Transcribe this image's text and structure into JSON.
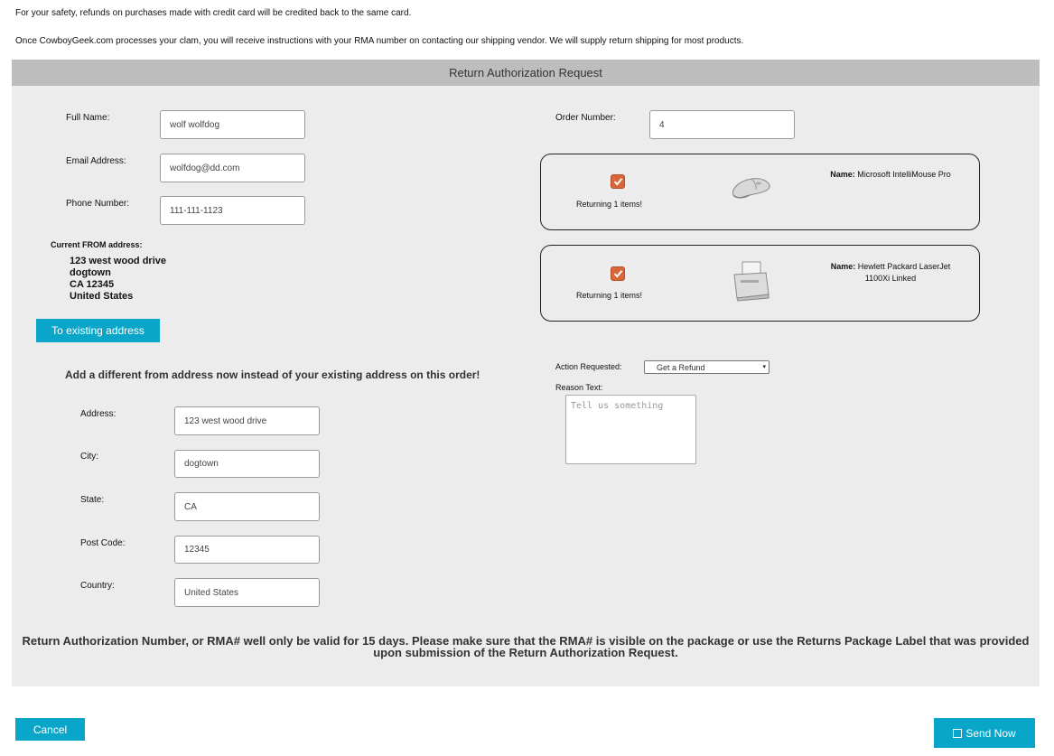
{
  "notes": {
    "refund": "For your safety, refunds on purchases made with credit card will be credited back to the same card.",
    "process": "Once CowboyGeek.com processes your clam, you will receive instructions with your RMA number on contacting our shipping vendor. We will supply return shipping for most products."
  },
  "form": {
    "title": "Return Authorization Request",
    "full_name": {
      "label": "Full Name:",
      "value": "wolf wolfdog"
    },
    "email": {
      "label": "Email Address:",
      "value": "wolfdog@dd.com"
    },
    "phone": {
      "label": "Phone Number:",
      "value": "111-111-1123"
    },
    "order_number": {
      "label": "Order Number:",
      "value": "4"
    },
    "current_from": {
      "label": "Current FROM address:",
      "lines": [
        "123 west wood drive",
        "dogtown",
        "CA 12345",
        "United States"
      ]
    },
    "to_existing_button": "To existing address",
    "different_address_heading": "Add a different from address now instead of your existing address on this order!",
    "address": {
      "label": "Address:",
      "value": "123 west wood drive"
    },
    "city": {
      "label": "City:",
      "value": "dogtown"
    },
    "state": {
      "label": "State:",
      "value": "CA"
    },
    "post_code": {
      "label": "Post Code:",
      "value": "12345"
    },
    "country": {
      "label": "Country:",
      "value": "United States"
    },
    "action": {
      "label": "Action Requested:",
      "value": "Get a Refund"
    },
    "reason": {
      "label": "Reason Text:",
      "placeholder": "Tell us something"
    },
    "items": [
      {
        "checked": true,
        "returning": "Returning 1 items!",
        "name_label": "Name:",
        "name": "Microsoft IntelliMouse Pro",
        "icon": "mouse-icon"
      },
      {
        "checked": true,
        "returning": "Returning 1 items!",
        "name_label": "Name:",
        "name": "Hewlett Packard LaserJet 1100Xi Linked",
        "icon": "printer-icon"
      }
    ],
    "rma_notice": "Return Authorization Number, or RMA# well only be valid for 15 days. Please make sure that the RMA# is visible on the package or use the Returns Package Label that was provided upon submission of the Return Authorization Request."
  },
  "footer": {
    "cancel": "Cancel",
    "send": "Send Now"
  },
  "colors": {
    "accent": "#0aa6c9",
    "checkbox": "#d9663a",
    "panel": "#ececec",
    "header": "#bdbdbd"
  }
}
